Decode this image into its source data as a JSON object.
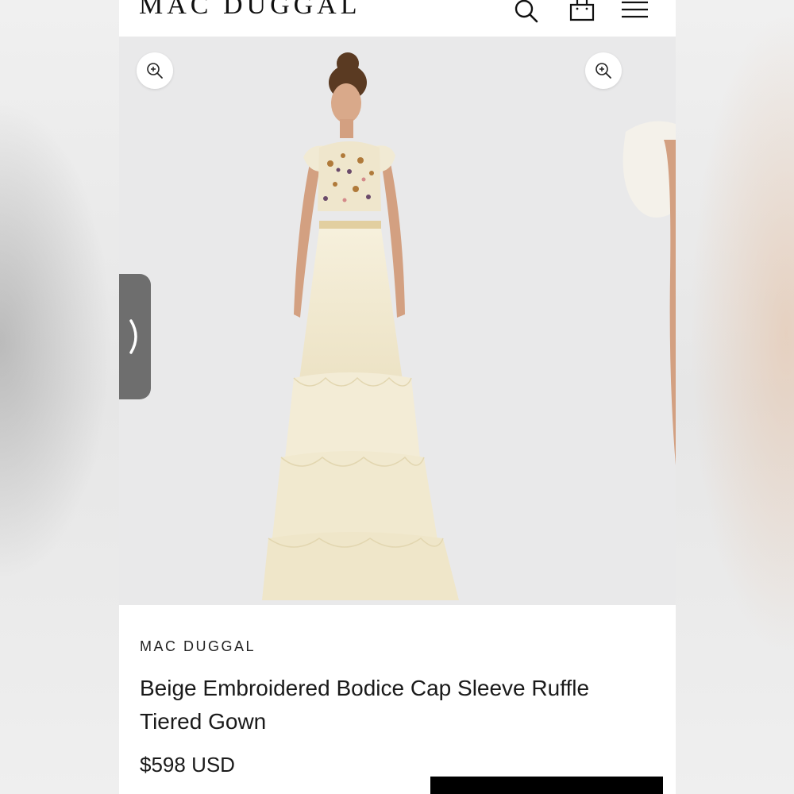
{
  "header": {
    "logo": "MAC DUGGAL",
    "icons": [
      "search-icon",
      "shopping-bag-icon",
      "hamburger-menu-icon"
    ]
  },
  "gallery": {
    "zoom_icon": "zoom-in-icon",
    "next_icon": "chevron-right-icon",
    "image_subject": "model wearing beige tiered ruffle gown with embroidered bodice"
  },
  "product": {
    "brand": "MAC DUGGAL",
    "title": "Beige Embroidered Bodice Cap Sleeve Ruffle Tiered Gown",
    "price": "$598 USD"
  },
  "colors": {
    "text": "#1a1a1a",
    "gallery_bg": "#e9e9ea",
    "next_tab": "#6e6e6e",
    "button": "#000000",
    "gown": "#f3ecd6"
  }
}
